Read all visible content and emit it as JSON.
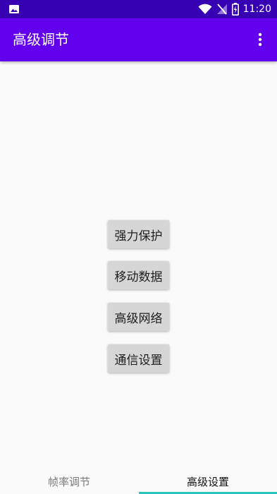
{
  "status_bar": {
    "time": "11:20",
    "icons": [
      "image-icon",
      "wifi-icon",
      "signal-off-icon",
      "battery-charging-icon"
    ],
    "background": "#3700b3"
  },
  "app_bar": {
    "title": "高级调节",
    "background": "#6200ee"
  },
  "actions": [
    {
      "label": "强力保护"
    },
    {
      "label": "移动数据"
    },
    {
      "label": "高级网络"
    },
    {
      "label": "通信设置"
    }
  ],
  "bottom_tabs": {
    "items": [
      {
        "label": "帧率调节"
      },
      {
        "label": "高级设置"
      }
    ],
    "selected": "高级设置",
    "indicator_color": "#26c6b8"
  }
}
